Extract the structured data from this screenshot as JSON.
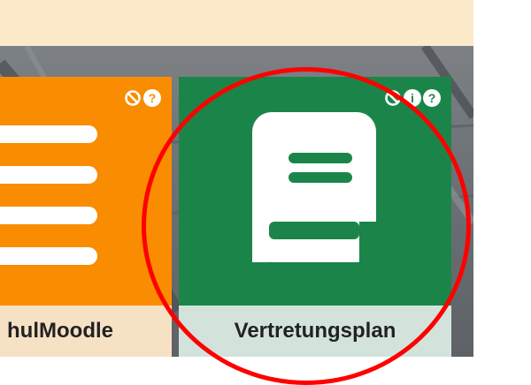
{
  "colors": {
    "banner": "#fbe9c9",
    "moodle_tile": "#f98c00",
    "moodle_footer": "#f7e1c4",
    "vplan_tile": "#1b8549",
    "vplan_footer": "#d3e3dc",
    "highlight": "#ff0000"
  },
  "tiles": [
    {
      "label": "hulMoodle",
      "icon": "menu-icon",
      "corner_icons": [
        "block-icon",
        "help-icon"
      ],
      "help_glyph": "?"
    },
    {
      "label": "Vertretungsplan",
      "icon": "book-icon",
      "corner_icons": [
        "block-icon",
        "info-icon",
        "help-icon"
      ],
      "info_glyph": "i",
      "help_glyph": "?"
    }
  ]
}
